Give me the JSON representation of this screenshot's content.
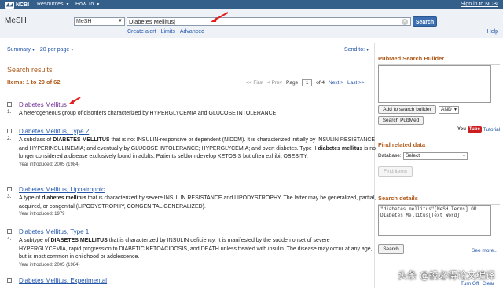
{
  "topbar": {
    "logo": "NCBI",
    "resources": "Resources",
    "howto": "How To",
    "signin": "Sign in to NCBI"
  },
  "header": {
    "db_title": "MeSH",
    "db_select": "MeSH",
    "query": "Diabetes Mellitus",
    "search_button": "Search",
    "links": [
      "Create alert",
      "Limits",
      "Advanced"
    ],
    "help": "Help"
  },
  "settings": {
    "summary": "Summary",
    "per_page": "20 per page",
    "send_to": "Send to:"
  },
  "results": {
    "title": "Search results",
    "items": "Items: 1 to 20 of 62",
    "pager": {
      "first": "<< First",
      "prev": "< Prev",
      "page_label": "Page",
      "page_value": "1",
      "of": "of 4",
      "next": "Next >",
      "last": "Last >>"
    },
    "list": [
      {
        "num": "1.",
        "title_main": "Diabetes Mellitus",
        "title_rest": "",
        "desc": "A heterogeneous group of disorders characterized by HYPERGLYCEMIA and GLUCOSE INTOLERANCE.",
        "year": ""
      },
      {
        "num": "2.",
        "title_main": "Diabetes Mellitus",
        "title_rest": ", Type 2",
        "desc": "A subclass of DIABETES MELLITUS that is not INSULIN-responsive or dependent (NIDDM). It is characterized initially by INSULIN RESISTANCE and HYPERINSULINEMIA; and eventually by GLUCOSE INTOLERANCE; HYPERGLYCEMIA; and overt diabetes. Type II diabetes mellitus is no longer considered a disease exclusively found in adults. Patients seldom develop KETOSIS but often exhibit OBESITY.",
        "year": "Year introduced: 2005 (1984)"
      },
      {
        "num": "3.",
        "title_main": "Diabetes Mellitus",
        "title_rest": ", Lipoatrophic",
        "desc": "A type of diabetes mellitus that is characterized by severe INSULIN RESISTANCE and LIPODYSTROPHY. The latter may be generalized, partial, acquired, or congenital (LIPODYSTROPHY, CONGENITAL GENERALIZED).",
        "year": "Year introduced: 1979"
      },
      {
        "num": "4.",
        "title_main": "Diabetes Mellitus",
        "title_rest": ", Type 1",
        "desc": "A subtype of DIABETES MELLITUS that is characterized by INSULIN deficiency. It is manifested by the sudden onset of severe HYPERGLYCEMIA, rapid progression to DIABETIC KETOACIDOSIS, and DEATH unless treated with insulin. The disease may occur at any age, but is most common in childhood or adolescence.",
        "year": "Year introduced: 2005 (1984)"
      },
      {
        "num": "5.",
        "title_main": "Diabetes Mellitus",
        "title_rest": ", Experimental",
        "desc": "",
        "year": ""
      }
    ]
  },
  "sidebar": {
    "builder_title": "PubMed Search Builder",
    "add_button": "Add to search builder",
    "and_select": "AND",
    "search_pubmed": "Search PubMed",
    "youtube": "You",
    "tube": "Tube",
    "tutorial": "Tutorial",
    "related_title": "Find related data",
    "database_label": "Database:",
    "database_select": "Select",
    "find_items": "Find items",
    "details_title": "Search details",
    "details_text": "\"diabetes mellitus\"[MeSH Terms] OR Diabetes Mellitus[Text Word]",
    "search_btn": "Search",
    "see_more": "See more...",
    "turn_off": "Turn Off",
    "clear": "Clear"
  },
  "watermark": "头条 @投必得论文编译",
  "colors": {
    "topbar": "#355f8b",
    "link": "#2255aa",
    "heading": "#b05a1a",
    "annotation": "#e02020"
  }
}
